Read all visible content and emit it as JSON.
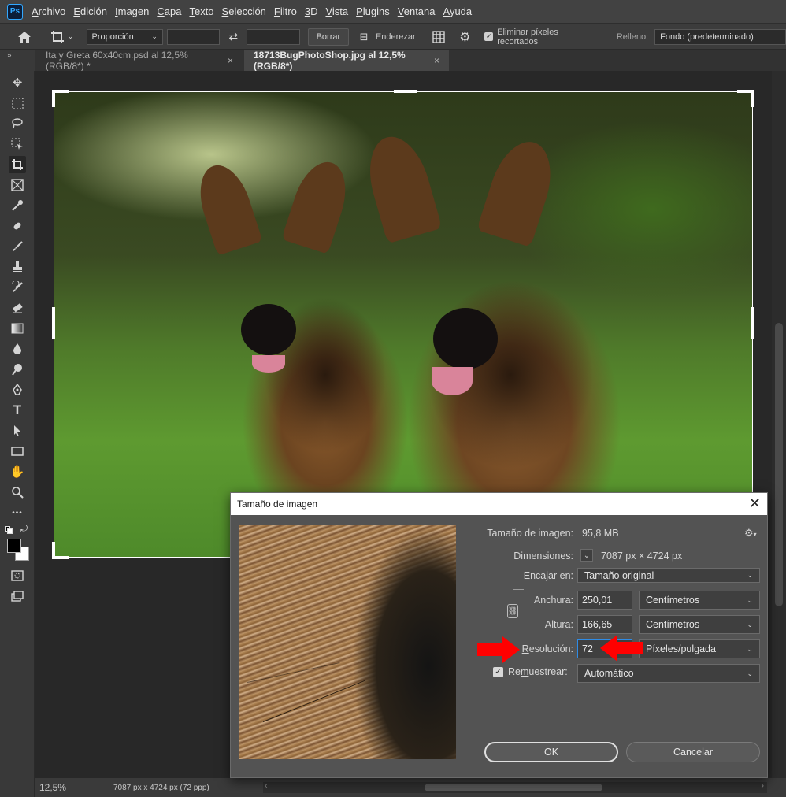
{
  "app": {
    "logo": "Ps",
    "menu": [
      {
        "label": "Archivo",
        "ul": "A",
        "rest": "rchivo"
      },
      {
        "label": "Edición",
        "ul": "E",
        "rest": "dición"
      },
      {
        "label": "Imagen",
        "ul": "I",
        "rest": "magen"
      },
      {
        "label": "Capa",
        "ul": "C",
        "rest": "apa"
      },
      {
        "label": "Texto",
        "ul": "T",
        "rest": "exto"
      },
      {
        "label": "Selección",
        "ul": "S",
        "rest": "elección"
      },
      {
        "label": "Filtro",
        "ul": "F",
        "rest": "iltro"
      },
      {
        "label": "3D",
        "ul": "3",
        "rest": "D"
      },
      {
        "label": "Vista",
        "ul": "V",
        "rest": "ista"
      },
      {
        "label": "Plugins",
        "ul": "P",
        "rest": "lugins"
      },
      {
        "label": "Ventana",
        "ul": "V",
        "rest": "entana"
      },
      {
        "label": "Ayuda",
        "ul": "A",
        "rest": "yuda"
      }
    ]
  },
  "options": {
    "ratio_select": "Proporción",
    "clear_button": "Borrar",
    "straighten_label": "Enderezar",
    "delete_cropped_label": "Eliminar píxeles recortados",
    "fill_label": "Relleno:",
    "fill_select": "Fondo (predeterminado)"
  },
  "tabs": {
    "panel_toggle": "»",
    "items": [
      {
        "label": "Ita y Greta 60x40cm.psd al 12,5% (RGB/8*) *",
        "close": "×"
      },
      {
        "label": "18713BugPhotoShop.jpg al 12,5% (RGB/8*)",
        "close": "×"
      }
    ]
  },
  "tools": {
    "more": "•••"
  },
  "status": {
    "zoom": "12,5%",
    "doc_info": "7087 px x 4724 px (72 ppp)",
    "chevron": "〉",
    "scroll_left": "‹",
    "scroll_right": "›"
  },
  "dialog": {
    "title": "Tamaño de imagen",
    "close": "✕",
    "image_size_label": "Tamaño de imagen:",
    "image_size_value": "95,8 MB",
    "dimensions_label": "Dimensiones:",
    "dimensions_value": "7087 px  ×  4724 px",
    "fit_label": "Encajar en:",
    "fit_value": "Tamaño original",
    "width_label": "Anchura:",
    "width_value": "250,01",
    "width_unit": "Centímetros",
    "height_label": "Altura:",
    "height_value": "166,65",
    "height_unit": "Centímetros",
    "resolution_label_ul": "R",
    "resolution_label_rest": "esolución:",
    "resolution_value": "72",
    "resolution_unit": "Píxeles/pulgada",
    "resample_label_ul": "Re",
    "resample_label_ul2": "m",
    "resample_label_rest": "uestrear:",
    "resample_value": "Automático",
    "ok": "OK",
    "cancel": "Cancelar"
  },
  "colors": {
    "accent_focus": "#2f8ce6",
    "annotation_arrow": "#ff0000"
  }
}
